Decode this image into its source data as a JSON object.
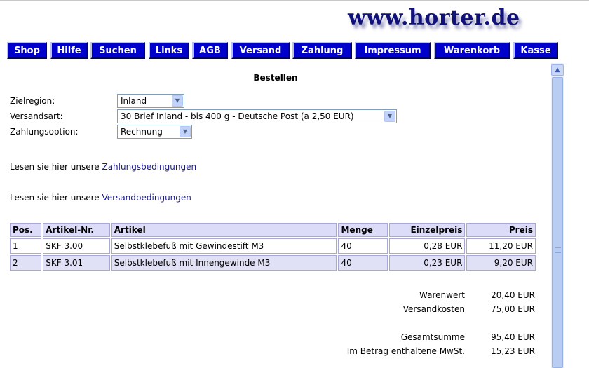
{
  "site": {
    "logo": "www.horter.de"
  },
  "nav": [
    {
      "label": "Shop"
    },
    {
      "label": "Hilfe"
    },
    {
      "label": "Suchen"
    },
    {
      "label": "Links"
    },
    {
      "label": "AGB"
    },
    {
      "label": "Versand"
    },
    {
      "label": "Zahlung"
    },
    {
      "label": "Impressum"
    },
    {
      "label": "Warenkorb"
    },
    {
      "label": "Kasse"
    }
  ],
  "page": {
    "title": "Bestellen"
  },
  "form": {
    "zielregion": {
      "label": "Zielregion:",
      "value": "Inland"
    },
    "versandart": {
      "label": "Versandsart:",
      "value": "30 Brief Inland - bis 400 g - Deutsche Post (a 2,50 EUR)"
    },
    "zahlungsoption": {
      "label": "Zahlungsoption:",
      "value": "Rechnung"
    }
  },
  "info": {
    "zahlung": {
      "prefix": "Lesen sie hier unsere ",
      "link": "Zahlungsbedingungen"
    },
    "versand": {
      "prefix": "Lesen sie hier unsere ",
      "link": "Versandbedingungen"
    }
  },
  "table": {
    "headers": [
      "Pos.",
      "Artikel-Nr.",
      "Artikel",
      "Menge",
      "Einzelpreis",
      "Preis"
    ],
    "rows": [
      [
        "1",
        "SKF 3.00",
        "Selbstklebefuß mit Gewindestift M3",
        "40",
        "0,28 EUR",
        "11,20 EUR"
      ],
      [
        "2",
        "SKF 3.01",
        "Selbstklebefuß mit Innengewinde M3",
        "40",
        "0,23 EUR",
        "9,20 EUR"
      ]
    ]
  },
  "summary": {
    "warenwert": {
      "label": "Warenwert",
      "value": "20,40 EUR"
    },
    "versandkosten": {
      "label": "Versandkosten",
      "value": "75,00 EUR"
    },
    "gesamtsumme": {
      "label": "Gesamtsumme",
      "value": "95,40 EUR"
    },
    "mwst": {
      "label": "Im Betrag enthaltene MwSt.",
      "value": "15,23 EUR"
    }
  },
  "colors": {
    "nav_bg": "#0000cc",
    "logo": "#10127a",
    "table_header": "#dcdcf8",
    "table_alt_row": "#e0e0f6"
  }
}
